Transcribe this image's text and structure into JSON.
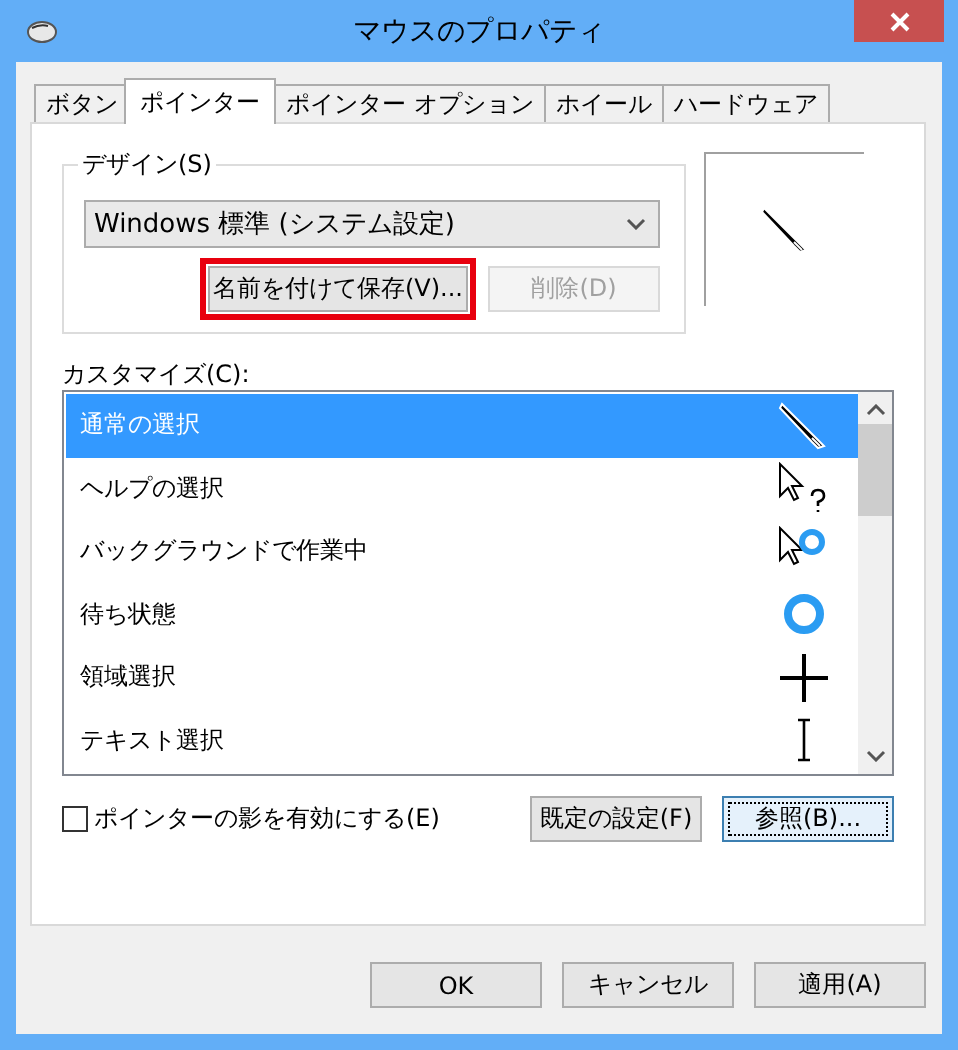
{
  "window": {
    "title": "マウスのプロパティ"
  },
  "tabs": [
    {
      "label": "ボタン",
      "selected": false
    },
    {
      "label": "ポインター",
      "selected": true
    },
    {
      "label": "ポインター オプション",
      "selected": false
    },
    {
      "label": "ホイール",
      "selected": false
    },
    {
      "label": "ハードウェア",
      "selected": false
    }
  ],
  "design": {
    "label": "デザイン(S)",
    "scheme": "Windows 標準 (システム設定)",
    "save_button": {
      "label": "名前を付けて保存(V)...",
      "highlighted": true
    },
    "delete_button": {
      "label": "削除(D)",
      "disabled": true
    }
  },
  "customize": {
    "label": "カスタマイズ(C):",
    "items": [
      {
        "label": "通常の選択",
        "kind": "pen",
        "selected": true
      },
      {
        "label": "ヘルプの選択",
        "kind": "help",
        "selected": false
      },
      {
        "label": "バックグラウンドで作業中",
        "kind": "working",
        "selected": false
      },
      {
        "label": "待ち状態",
        "kind": "busy",
        "selected": false
      },
      {
        "label": "領域選択",
        "kind": "cross",
        "selected": false
      },
      {
        "label": "テキスト選択",
        "kind": "text",
        "selected": false
      }
    ]
  },
  "shadow_checkbox": {
    "label": "ポインターの影を有効にする(E)",
    "checked": false
  },
  "buttons": [
    {
      "label": "既定の設定(F)",
      "focused": false
    },
    {
      "label": "参照(B)...",
      "focused": true
    }
  ],
  "dialog_buttons": [
    {
      "label": "OK"
    },
    {
      "label": "キャンセル"
    },
    {
      "label": "適用(A)"
    }
  ]
}
